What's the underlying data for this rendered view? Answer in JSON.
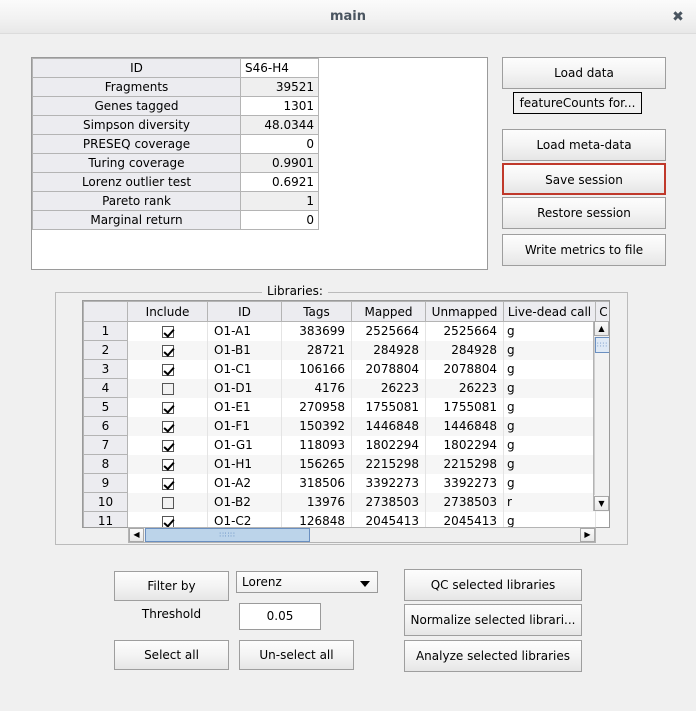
{
  "window": {
    "title": "main",
    "close_label": "✖"
  },
  "metrics": {
    "rows": [
      {
        "label": "ID",
        "value": "S46-H4",
        "is_id": true
      },
      {
        "label": "Fragments",
        "value": "39521"
      },
      {
        "label": "Genes tagged",
        "value": "1301"
      },
      {
        "label": "Simpson diversity",
        "value": "48.0344"
      },
      {
        "label": "PRESEQ coverage",
        "value": "0"
      },
      {
        "label": "Turing coverage",
        "value": "0.9901"
      },
      {
        "label": "Lorenz outlier test",
        "value": "0.6921"
      },
      {
        "label": "Pareto rank",
        "value": "1"
      },
      {
        "label": "Marginal return",
        "value": "0"
      }
    ]
  },
  "actions": {
    "load_data": "Load data",
    "feature_counts": "featureCounts for...",
    "load_meta_data": "Load meta-data",
    "save_session": "Save session",
    "restore_session": "Restore session",
    "write_metrics": "Write metrics to file",
    "focus_color": "#c0392b"
  },
  "libraries": {
    "group_title": "Libraries:",
    "columns": [
      "",
      "Include",
      "ID",
      "Tags",
      "Mapped",
      "Unmapped",
      "Live-dead call",
      "C"
    ],
    "rows": [
      {
        "num": "1",
        "include": true,
        "id": "O1-A1",
        "tags": "383699",
        "mapped": "2525664",
        "unmapped": "2525664",
        "ldc": "g"
      },
      {
        "num": "2",
        "include": true,
        "id": "O1-B1",
        "tags": "28721",
        "mapped": "284928",
        "unmapped": "284928",
        "ldc": "g"
      },
      {
        "num": "3",
        "include": true,
        "id": "O1-C1",
        "tags": "106166",
        "mapped": "2078804",
        "unmapped": "2078804",
        "ldc": "g"
      },
      {
        "num": "4",
        "include": false,
        "id": "O1-D1",
        "tags": "4176",
        "mapped": "26223",
        "unmapped": "26223",
        "ldc": "g"
      },
      {
        "num": "5",
        "include": true,
        "id": "O1-E1",
        "tags": "270958",
        "mapped": "1755081",
        "unmapped": "1755081",
        "ldc": "g"
      },
      {
        "num": "6",
        "include": true,
        "id": "O1-F1",
        "tags": "150392",
        "mapped": "1446848",
        "unmapped": "1446848",
        "ldc": "g"
      },
      {
        "num": "7",
        "include": true,
        "id": "O1-G1",
        "tags": "118093",
        "mapped": "1802294",
        "unmapped": "1802294",
        "ldc": "g"
      },
      {
        "num": "8",
        "include": true,
        "id": "O1-H1",
        "tags": "156265",
        "mapped": "2215298",
        "unmapped": "2215298",
        "ldc": "g"
      },
      {
        "num": "9",
        "include": true,
        "id": "O1-A2",
        "tags": "318506",
        "mapped": "3392273",
        "unmapped": "3392273",
        "ldc": "g"
      },
      {
        "num": "10",
        "include": false,
        "id": "O1-B2",
        "tags": "13976",
        "mapped": "2738503",
        "unmapped": "2738503",
        "ldc": "r"
      },
      {
        "num": "11",
        "include": true,
        "id": "O1-C2",
        "tags": "126848",
        "mapped": "2045413",
        "unmapped": "2045413",
        "ldc": "g"
      }
    ],
    "scroll": {
      "up_arrow": "▲",
      "down_arrow": "▼",
      "left_arrow": "◀",
      "right_arrow": "▶"
    }
  },
  "controls": {
    "filter_by": "Filter by",
    "filter_value": "Lorenz",
    "threshold_label": "Threshold",
    "threshold_value": "0.05",
    "select_all": "Select all",
    "unselect_all": "Un-select all",
    "qc_selected": "QC selected libraries",
    "normalize_selected": "Normalize selected librari...",
    "analyze_selected": "Analyze selected libraries"
  }
}
